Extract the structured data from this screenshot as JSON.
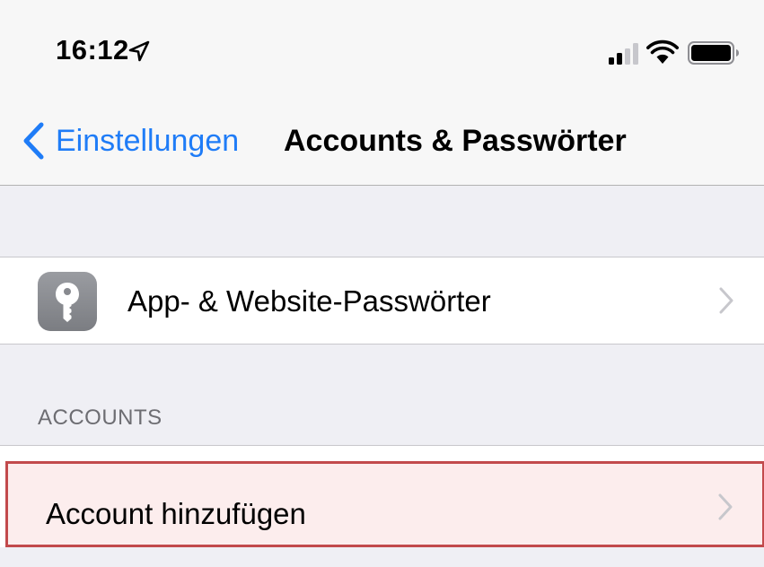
{
  "status_bar": {
    "time": "16:12",
    "location_icon": "location-arrow-icon",
    "signal_icon": "cellular-signal-icon",
    "wifi_icon": "wifi-icon",
    "battery_icon": "battery-icon"
  },
  "nav": {
    "back_label": "Einstellungen",
    "title": "Accounts & Passwörter",
    "accent_color": "#1f7cf7"
  },
  "passwords_cell": {
    "label": "App- & Website-Passwörter",
    "icon": "key-icon"
  },
  "accounts_section": {
    "header": "ACCOUNTS",
    "add_account_label": "Account hinzufügen",
    "highlight_color": "#c24a4c"
  }
}
